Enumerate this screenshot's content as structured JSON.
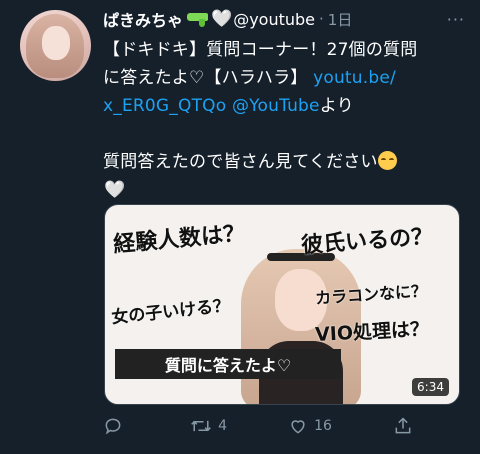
{
  "tweet": {
    "display_name": "ぱきみちゃ",
    "handle": "@youtube",
    "separator": "·",
    "time": "1日",
    "more": "···",
    "text_line1": "【ドキドキ】質問コーナー！27個の質問",
    "text_line2_start": "に答えたよ♡【ハラハラ】 ",
    "link1": "youtu.be/",
    "link2": "x_ER0G_QTQo",
    "mention": "@YouTube",
    "text_after_link": "より",
    "line_question": "質問答えたので皆さん見てください",
    "heart_glyph": "🤍"
  },
  "video_card": {
    "questions": [
      "経験人数は？",
      "彼氏いるの？",
      "女の子いける？",
      "カラコンなに？",
      "VIO処理は？"
    ],
    "caption": "質問に答えたよ♡",
    "duration": "6:34"
  },
  "actions": {
    "reply_count": "",
    "retweet_count": "4",
    "like_count": "16"
  },
  "colors": {
    "background": "#15202b",
    "link": "#1da1f2",
    "muted": "#8899a6"
  }
}
